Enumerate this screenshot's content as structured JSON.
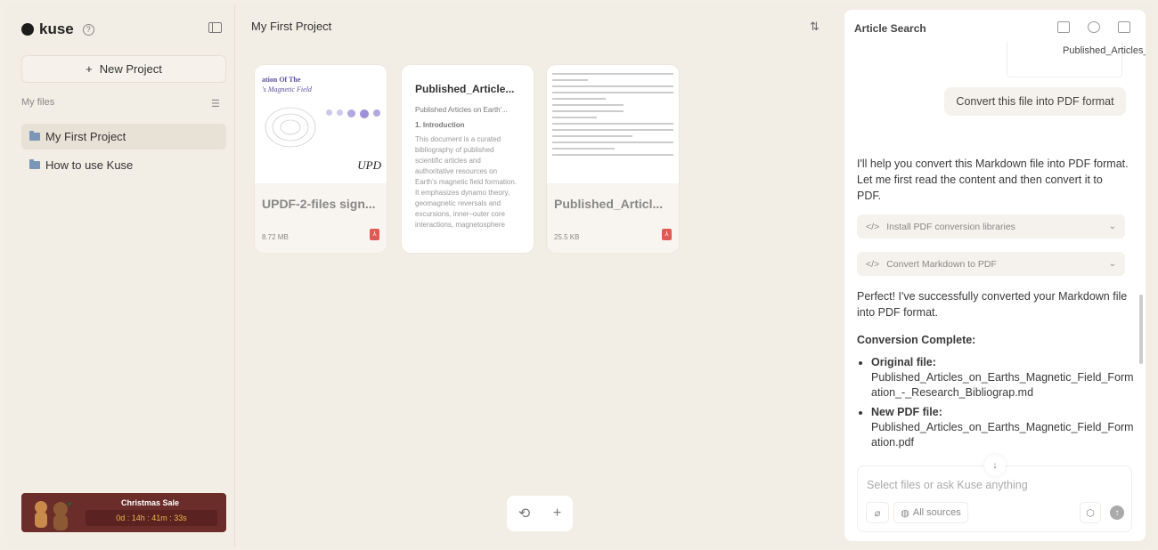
{
  "sidebar": {
    "brand": "kuse",
    "new_project": "New Project",
    "my_files": "My files",
    "folders": [
      {
        "label": "My First Project",
        "active": true
      },
      {
        "label": "How to use Kuse",
        "active": false
      }
    ],
    "promo": {
      "title": "Christmas Sale",
      "timer": "0d : 14h : 41m : 33s"
    }
  },
  "main": {
    "title": "My First Project",
    "cards": [
      {
        "name": "UPDF-2-files sign...",
        "size": "8.72 MB",
        "thumb_title": "ation Of The",
        "thumb_subtitle": "'s Magnetic Field",
        "thumb_logo": "UPD"
      },
      {
        "title": "Published_Article...",
        "subtitle": "Published Articles on Earth'...",
        "heading": "1. Introduction",
        "body": "This document is a curated bibliography of published scientific articles and authoritative resources on Earth's magnetic field formation. It emphasizes dynamo theory, geomagnetic reversals and excursions, inner–outer core interactions, magnetosphere"
      },
      {
        "name": "Published_Articl...",
        "size": "25.5 KB"
      }
    ]
  },
  "chat": {
    "title": "Article Search",
    "attachment": "Published_Articles_on_...",
    "user_message": "Convert this file into PDF format",
    "ai_intro": "I'll help you convert this Markdown file into PDF format. Let me first read the content and then convert it to PDF.",
    "tools": [
      "Install PDF conversion libraries",
      "Convert Markdown to PDF"
    ],
    "ai_done": "Perfect! I've successfully converted your Markdown file into PDF format.",
    "complete_heading": "Conversion Complete:",
    "items": [
      {
        "label": "Original file:",
        "value": "Published_Articles_on_Earths_Magnetic_Field_Formation_-_Research_Bibliograp.md"
      },
      {
        "label": "New PDF file:",
        "value": "Published_Articles_on_Earths_Magnetic_Field_Formation.pdf"
      }
    ],
    "input_placeholder": "Select files or ask Kuse anything",
    "all_sources": "All sources"
  }
}
